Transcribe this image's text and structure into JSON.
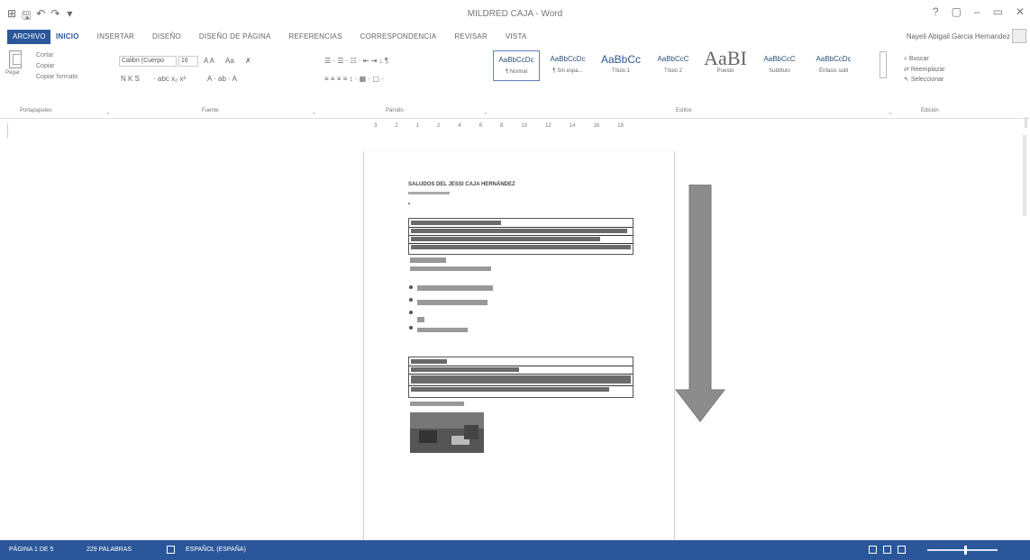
{
  "window": {
    "title": "MILDRED CAJA - Word",
    "controls": [
      "?",
      "▢",
      "–",
      "▭",
      "✕"
    ]
  },
  "qat": {
    "items": [
      "⊞",
      "🖫",
      "↶",
      "↷",
      "▾"
    ]
  },
  "tabs": {
    "file": "ARCHIVO",
    "items": [
      "INICIO",
      "INSERTAR",
      "DISEÑO",
      "DISEÑO DE PÁGINA",
      "REFERENCIAS",
      "CORRESPONDENCIA",
      "REVISAR",
      "VISTA"
    ],
    "active": "INICIO",
    "user": "Nayeli Abigail Garcia Hernandez"
  },
  "ribbon": {
    "clipboard": {
      "paste": "Pegar",
      "cut": "Cortar",
      "copy": "Copiar",
      "format_painter": "Copiar formato",
      "label": "Portapapeles"
    },
    "font": {
      "name": "Calibri (Cuerpo",
      "size": "16",
      "grow_shrink": "A A",
      "case": "Aa",
      "clear": "✗",
      "bold_italic": "N K S",
      "more": "· abc x₂ x²",
      "effects": "A · ab · A",
      "label": "Fuente"
    },
    "paragraph": {
      "row1": "☰ · ☰ · ☷ ·   ⇤ ⇥   ↓  ¶",
      "row2": "≡ ≡ ≡ ≡   ↕ ·  ▦ · ▢ ·",
      "label": "Párrafo"
    },
    "styles": {
      "items": [
        {
          "preview": "AaBbCcDc",
          "name": "¶ Normal"
        },
        {
          "preview": "AaBbCcDc",
          "name": "¶ Sin espa..."
        },
        {
          "preview": "AaBbCc",
          "name": "Título 1"
        },
        {
          "preview": "AaBbCcC",
          "name": "Título 2"
        },
        {
          "preview": "AaBI",
          "name": "Puesto"
        },
        {
          "preview": "AaBbCcC",
          "name": "Subtítulo"
        },
        {
          "preview": "AaBbCcDc",
          "name": "Énfasis sutil"
        }
      ],
      "label": "Estilos"
    },
    "editing": {
      "find": "Buscar",
      "replace": "Reemplazar",
      "select": "Seleccionar",
      "label": "Edición"
    }
  },
  "ruler": {
    "numbers": [
      "3",
      "2",
      "1",
      "2",
      "4",
      "6",
      "8",
      "10",
      "12",
      "14",
      "16",
      "18"
    ]
  },
  "document": {
    "heading": "SALUDOS DEL JESSI CAJA HERNÁNDEZ"
  },
  "status": {
    "page": "PÁGINA 1 DE 5",
    "words": "229 PALABRAS",
    "language": "ESPAÑOL (ESPAÑA)"
  },
  "colors": {
    "accent": "#2b579a",
    "arrow_fill": "#8c8c8c"
  }
}
